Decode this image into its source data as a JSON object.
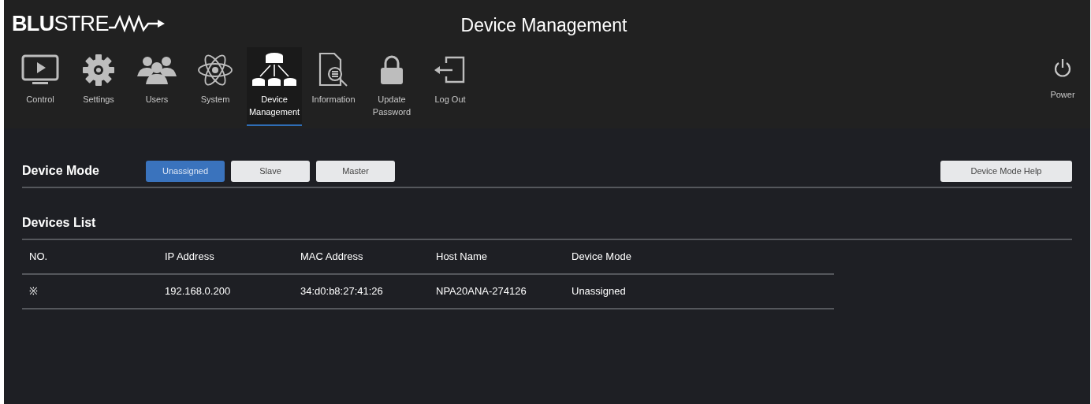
{
  "logo": {
    "bold": "BLU",
    "light": "STRE"
  },
  "title": "Device Management",
  "nav": [
    {
      "kind": "control",
      "label": "Control",
      "selected": false
    },
    {
      "kind": "settings",
      "label": "Settings",
      "selected": false
    },
    {
      "kind": "users",
      "label": "Users",
      "selected": false
    },
    {
      "kind": "system",
      "label": "System",
      "selected": false
    },
    {
      "kind": "devices",
      "label": "Device Management",
      "selected": true
    },
    {
      "kind": "information",
      "label": "Information",
      "selected": false
    },
    {
      "kind": "password",
      "label": "Update Password",
      "selected": false
    },
    {
      "kind": "logout",
      "label": "Log Out",
      "selected": false
    }
  ],
  "power": {
    "label": "Power"
  },
  "device_mode": {
    "label": "Device Mode",
    "options": [
      {
        "label": "Unassigned",
        "selected": true
      },
      {
        "label": "Slave",
        "selected": false
      },
      {
        "label": "Master",
        "selected": false
      }
    ],
    "help_button": "Device Mode Help"
  },
  "devices_list": {
    "title": "Devices List",
    "columns": [
      "NO.",
      "IP Address",
      "MAC Address",
      "Host Name",
      "Device Mode"
    ],
    "rows": [
      [
        "※",
        "192.168.0.200",
        "34:d0:b8:27:41:26",
        "NPA20ANA-274126",
        "Unassigned"
      ]
    ]
  }
}
